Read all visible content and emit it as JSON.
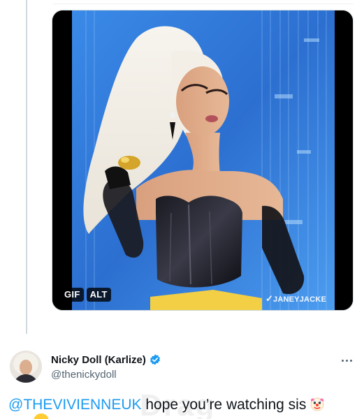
{
  "media": {
    "badges": {
      "gif": "GIF",
      "alt": "ALT"
    },
    "watermark": "JANEYJACKE"
  },
  "reply": {
    "author_name": "Nicky Doll (Karlize)",
    "handle": "@thenickydoll",
    "mention": "@THEVIVIENNEUK",
    "text": " hope you’re watching sis",
    "emoji_icon": "clown-face-icon",
    "verified_color": "#1d9bf0"
  },
  "colors": {
    "link": "#1d9bf0",
    "secondary_text": "#536471",
    "stage_blue": "#2f78d6"
  }
}
